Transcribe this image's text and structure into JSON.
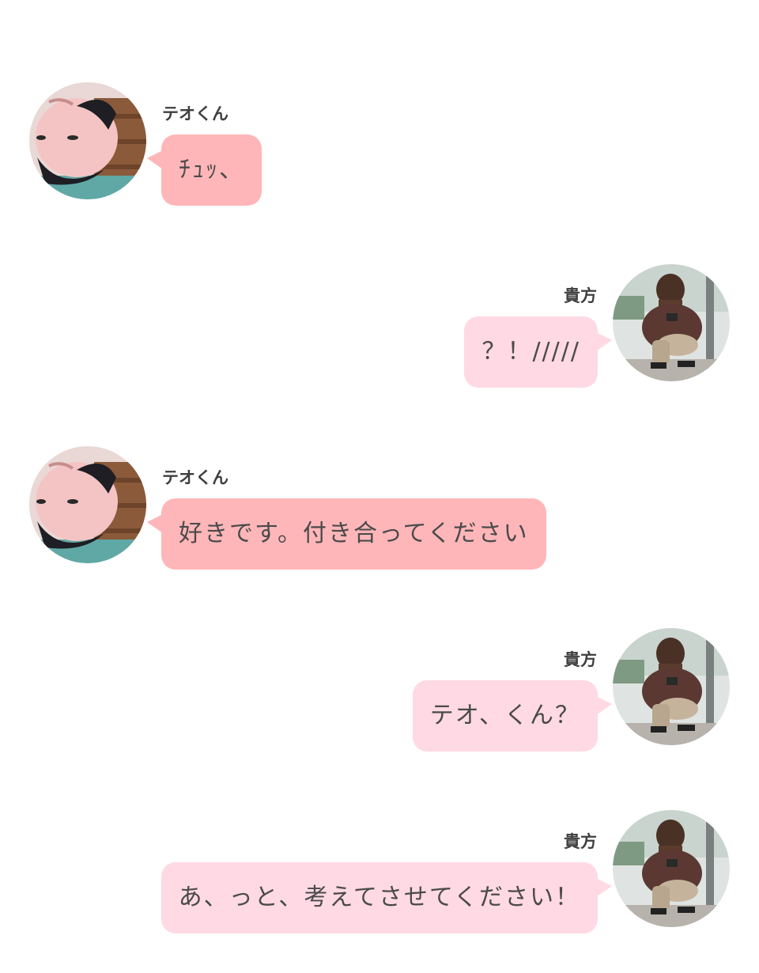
{
  "colors": {
    "teo_bubble": "#ffb6b9",
    "you_bubble": "#ffd9e4",
    "name_text": "#3f3f3f",
    "message_text": "#4a4a4a"
  },
  "messages": [
    {
      "side": "left",
      "sender": "テオくん",
      "avatar": "teo-avatar",
      "text": "ﾁｭｯ、"
    },
    {
      "side": "right",
      "sender": "貴方",
      "avatar": "you-avatar",
      "text": "？！/////"
    },
    {
      "side": "left",
      "sender": "テオくん",
      "avatar": "teo-avatar",
      "text": "好きです。付き合ってください"
    },
    {
      "side": "right",
      "sender": "貴方",
      "avatar": "you-avatar",
      "text": "テオ、くん？"
    },
    {
      "side": "right",
      "sender": "貴方",
      "avatar": "you-avatar",
      "text": "あ、っと、考えてさせてください！"
    }
  ]
}
